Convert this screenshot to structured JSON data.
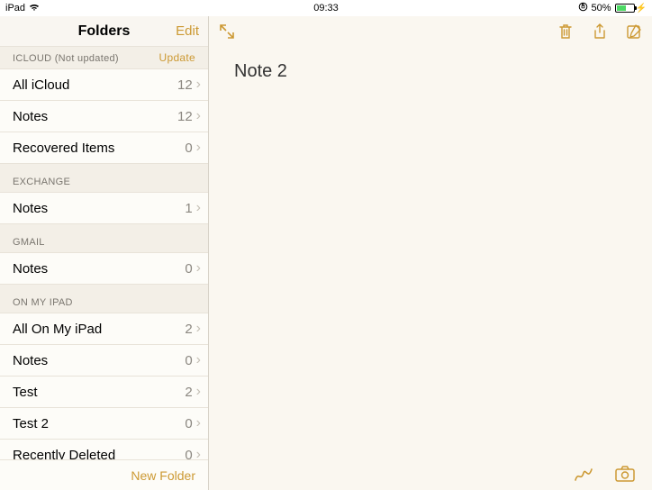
{
  "statusbar": {
    "device": "iPad",
    "time": "09:33",
    "battery_percent": "50%"
  },
  "sidebar": {
    "title": "Folders",
    "edit": "Edit",
    "new_folder": "New Folder",
    "sections": [
      {
        "header": "ICLOUD (Not updated)",
        "action": "Update",
        "folders": [
          {
            "label": "All iCloud",
            "count": "12"
          },
          {
            "label": "Notes",
            "count": "12"
          },
          {
            "label": "Recovered Items",
            "count": "0"
          }
        ]
      },
      {
        "header": "EXCHANGE",
        "folders": [
          {
            "label": "Notes",
            "count": "1"
          }
        ]
      },
      {
        "header": "GMAIL",
        "folders": [
          {
            "label": "Notes",
            "count": "0"
          }
        ]
      },
      {
        "header": "ON MY IPAD",
        "folders": [
          {
            "label": "All On My iPad",
            "count": "2"
          },
          {
            "label": "Notes",
            "count": "0"
          },
          {
            "label": "Test",
            "count": "2"
          },
          {
            "label": "Test 2",
            "count": "0"
          },
          {
            "label": "Recently Deleted",
            "count": "0"
          }
        ]
      }
    ]
  },
  "note": {
    "title": "Note 2"
  },
  "icons": {
    "fullscreen": "fullscreen-icon",
    "trash": "trash-icon",
    "share": "share-icon",
    "compose": "compose-icon",
    "draw": "draw-icon",
    "camera": "camera-icon"
  }
}
